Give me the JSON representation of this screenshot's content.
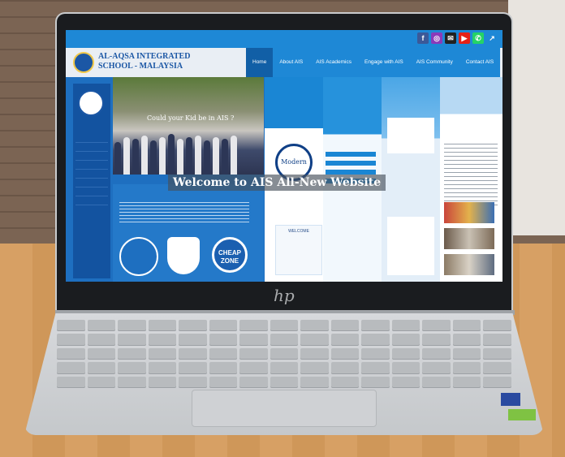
{
  "site": {
    "school_name_line1": "AL-AQSA INTEGRATED",
    "school_name_line2": "SCHOOL - MALAYSIA",
    "nav": [
      "Home",
      "About AIS",
      "AIS Academics",
      "Engage with AIS",
      "AIS Community",
      "Contact AIS"
    ],
    "social": [
      {
        "icon": "facebook-icon",
        "glyph": "f",
        "color": "#3b5998"
      },
      {
        "icon": "instagram-icon",
        "glyph": "◎",
        "color": "#8a3ab9"
      },
      {
        "icon": "email-icon",
        "glyph": "✉",
        "color": "#222222"
      },
      {
        "icon": "youtube-icon",
        "glyph": "▶",
        "color": "#e62117"
      },
      {
        "icon": "whatsapp-icon",
        "glyph": "✆",
        "color": "#25d366"
      },
      {
        "icon": "link-icon",
        "glyph": "↗",
        "color": "#1e88d6"
      }
    ],
    "hero_caption": "Could your Kid be in AIS ?",
    "banner": "Welcome to AIS All-New Website",
    "modern_label": "Modern",
    "cheap_zone": "CHEAP ZONE",
    "doodle_text": "WELCOME"
  },
  "laptop": {
    "brand": "hp"
  },
  "colors": {
    "accent": "#1e88d6",
    "dark_blue": "#1353a0"
  }
}
